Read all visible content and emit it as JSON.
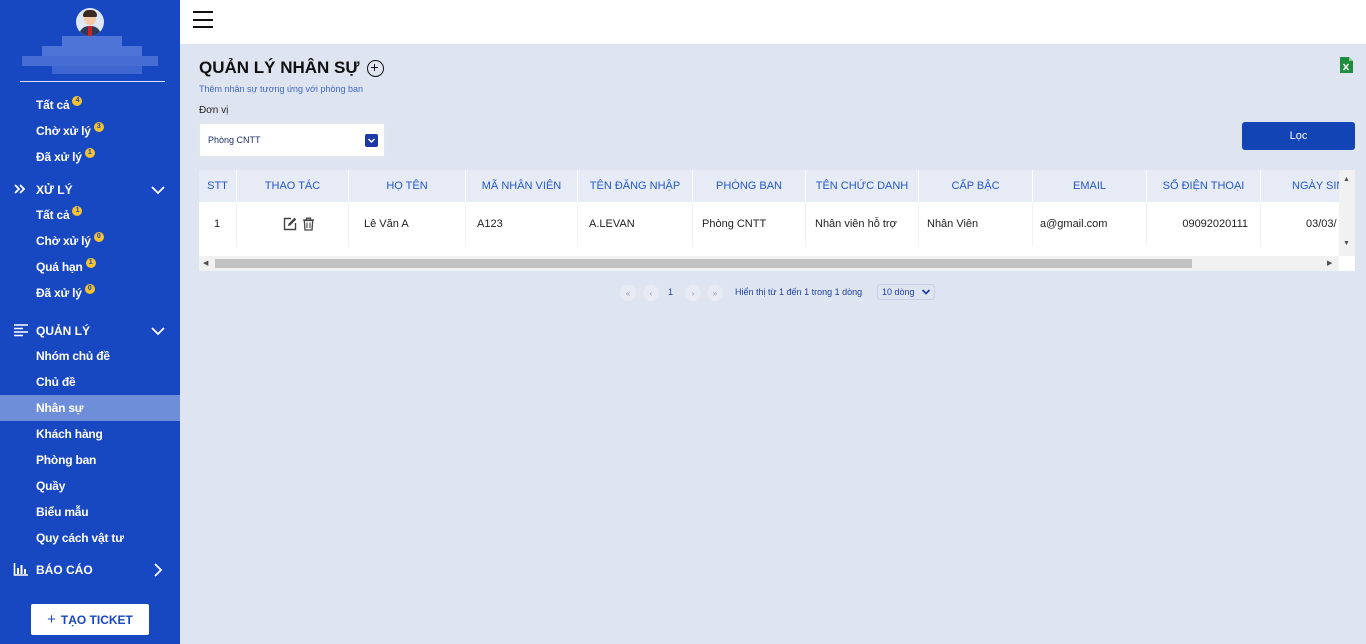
{
  "sidebar": {
    "status_items": [
      {
        "label": "Tất cả",
        "badge": "4"
      },
      {
        "label": "Chờ xử lý",
        "badge": "3"
      },
      {
        "label": "Đã xử lý",
        "badge": "1"
      }
    ],
    "process_section": {
      "title": "XỬ LÝ",
      "items": [
        {
          "label": "Tất cả",
          "badge": "1"
        },
        {
          "label": "Chờ xử lý",
          "badge": "0"
        },
        {
          "label": "Quá hạn",
          "badge": "1"
        },
        {
          "label": "Đã xử lý",
          "badge": "0"
        }
      ]
    },
    "manage_section": {
      "title": "QUẢN LÝ",
      "items": [
        {
          "label": "Nhóm chủ đề"
        },
        {
          "label": "Chủ đề"
        },
        {
          "label": "Nhân sự",
          "active": true
        },
        {
          "label": "Khách hàng"
        },
        {
          "label": "Phòng ban"
        },
        {
          "label": "Quầy"
        },
        {
          "label": "Biểu mẫu"
        },
        {
          "label": "Quy cách vật tư"
        }
      ]
    },
    "report_section": {
      "title": "BÁO CÁO"
    },
    "create_button": "TẠO TICKET"
  },
  "page": {
    "title": "QUẢN LÝ NHÂN SỰ",
    "subtitle": "Thêm nhân sự tương ứng với phòng ban",
    "filter_label": "Đơn vị",
    "unit_value": "Phòng CNTT",
    "filter_button": "Lọc"
  },
  "table": {
    "columns": [
      "STT",
      "THAO TÁC",
      "HỌ TÊN",
      "MÃ NHÂN VIÊN",
      "TÊN ĐĂNG NHẬP",
      "PHÒNG BAN",
      "TÊN CHỨC DANH",
      "CẤP BẬC",
      "EMAIL",
      "SỐ ĐIỆN THOẠI",
      "NGÀY SIN"
    ],
    "rows": [
      {
        "stt": "1",
        "name": "Lê Văn A",
        "code": "A123",
        "username": "A.LEVAN",
        "department": "Phòng CNTT",
        "position": "Nhân viên hỗ trợ",
        "rank": "Nhân Viên",
        "email": "a@gmail.com",
        "phone": "09092020111",
        "dob": "03/03/"
      }
    ]
  },
  "pagination": {
    "first": "«",
    "prev": "‹",
    "page": "1",
    "next": "›",
    "last": "»",
    "info": "Hiển thị từ 1 đến 1 trong 1 dòng",
    "page_size": "10 dòng"
  }
}
